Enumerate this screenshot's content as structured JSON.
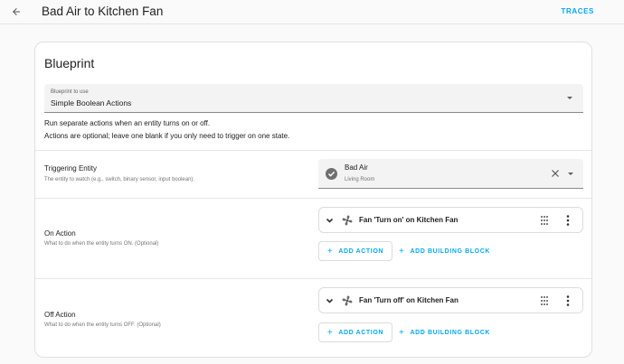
{
  "header": {
    "title": "Bad Air to Kitchen Fan",
    "traces_label": "TRACES",
    "back_icon": "arrow-left-icon"
  },
  "blueprint": {
    "title": "Blueprint",
    "select": {
      "label": "Blueprint to use",
      "value": "Simple Boolean Actions"
    },
    "description_lines": [
      "Run separate actions when an entity turns on or off.",
      "Actions are optional; leave one blank if you only need to trigger on one state."
    ]
  },
  "inputs": {
    "triggering_entity": {
      "title": "Triggering Entity",
      "subtitle": "The entity to watch (e.g., switch, binary sensor, input boolean).",
      "entity_name": "Bad Air",
      "entity_area": "Living Room"
    },
    "on_action": {
      "title": "On Action",
      "subtitle": "What to do when the entity turns ON. (Optional)",
      "action_text": "Fan 'Turn on' on Kitchen Fan",
      "add_action_label": "ADD ACTION",
      "add_block_label": "ADD BUILDING BLOCK"
    },
    "off_action": {
      "title": "Off Action",
      "subtitle": "What to do when the entity turns OFF. (Optional)",
      "action_text": "Fan 'Turn off' on Kitchen Fan",
      "add_action_label": "ADD ACTION",
      "add_block_label": "ADD BUILDING BLOCK"
    }
  },
  "colors": {
    "accent": "#03a9f4",
    "text": "#212121",
    "secondary_text": "#757575"
  }
}
